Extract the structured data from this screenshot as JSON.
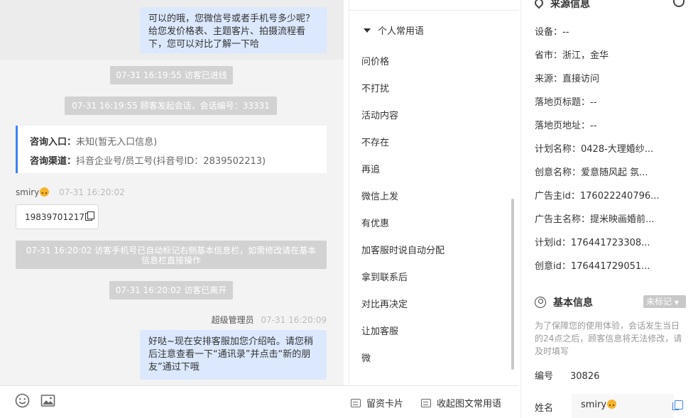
{
  "chat": {
    "top_bubble": "可以的哦，您微信号或者手机号多少呢？给您发价格表、主题客片、拍摄流程看下，您可以对比了解一下哈",
    "sys_enter": "07-31 16:19:55 访客已进线",
    "sys_session": "07-31 16:19:55 顾客发起会话，会话编号：33331",
    "info_entry_label": "咨询入口：",
    "info_entry_value": "未知(暂无入口信息)",
    "info_channel_label": "咨询渠道：",
    "info_channel_value": "抖音企业号/员工号(抖音号ID：2839502213)",
    "visitor_name": "smiry",
    "visitor_time": "07-31 16:20:02",
    "visitor_phone": "19839701217",
    "sys_phone_marked": "07-31 16:20:02 访客手机号已自动标记右侧基本信息栏，如需修改请在基本信息栏直接操作",
    "sys_left": "07-31 16:20:02 访客已离开",
    "agent_name": "超级管理员",
    "agent_time": "07-31 16:20:09",
    "agent_bubble": "好哒~现在安排客服加您介绍哈。请您稍后注意查看一下“通讯录”并点击“新的朋友”通过下哦"
  },
  "toolbar": {
    "emoji_icon": "smiley-icon",
    "image_icon": "image-icon",
    "card_btn": "留资卡片",
    "phrase_btn": "收起图文常用语"
  },
  "phrases": {
    "group_label": "个人常用语",
    "items": [
      "问价格",
      "不打扰",
      "活动内容",
      "不存在",
      "再追",
      "微信上发",
      "有优惠",
      "加客服时说自动分配",
      "拿到联系后",
      "对比再决定",
      "让加客服",
      "微"
    ]
  },
  "source": {
    "title": "来源信息",
    "rows": [
      {
        "label": "设备：",
        "value": "--"
      },
      {
        "label": "省市：",
        "value": "浙江，金华"
      },
      {
        "label": "来源：",
        "value": "直接访问"
      },
      {
        "label": "落地页标题：",
        "value": "--"
      },
      {
        "label": "落地页地址：",
        "value": "--"
      },
      {
        "label": "计划名称：",
        "value": "0428-大理婚纱..."
      },
      {
        "label": "创意名称：",
        "value": "爱意随风起 氛..."
      },
      {
        "label": "广告主id：",
        "value": "176022240796..."
      },
      {
        "label": "广告主名称：",
        "value": "提米映画婚前..."
      },
      {
        "label": "计划id：",
        "value": "176441723308..."
      },
      {
        "label": "创意id：",
        "value": "176441729051..."
      }
    ]
  },
  "basic": {
    "title": "基本信息",
    "tag": "未标记",
    "note": "为了保障您的使用体验，会话发生当日的24点之后，顾客信息将无法修改，请及时填写",
    "id_label": "编号",
    "id_value": "30826",
    "name_label": "姓名",
    "name_value": "smiry"
  }
}
